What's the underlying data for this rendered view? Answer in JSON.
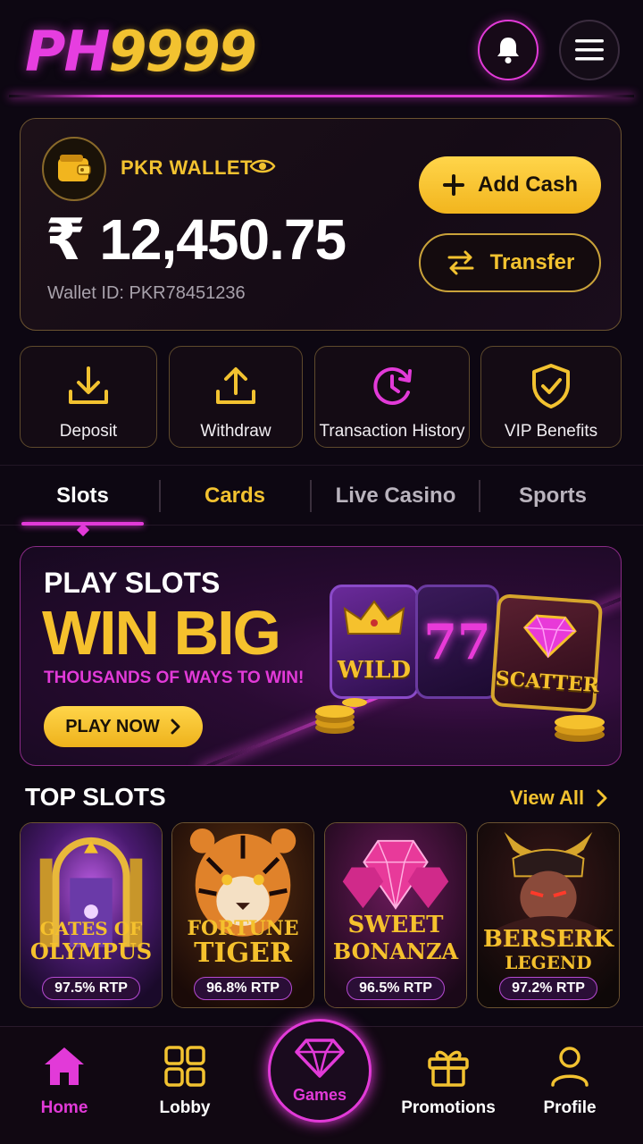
{
  "header": {
    "logo_ph": "PH",
    "logo_num": "9999",
    "icons": [
      "bell-icon",
      "menu-icon"
    ]
  },
  "wallet": {
    "label": "PKR WALLET",
    "currency_symbol": "₹",
    "amount": "12,450.75",
    "wallet_id": "Wallet ID: PKR78451236",
    "add_cash_label": "Add Cash",
    "transfer_label": "Transfer"
  },
  "quick_actions": [
    {
      "label": "Deposit",
      "icon": "download-icon"
    },
    {
      "label": "Withdraw",
      "icon": "upload-icon"
    },
    {
      "label": "Transaction History",
      "icon": "history-icon"
    },
    {
      "label": "VIP Benefits",
      "icon": "shield-check-icon"
    }
  ],
  "tabs": [
    {
      "label": "Slots",
      "active": true
    },
    {
      "label": "Cards",
      "active": false
    },
    {
      "label": "Live Casino",
      "active": false
    },
    {
      "label": "Sports",
      "active": false
    }
  ],
  "banner": {
    "line1": "PLAY SLOTS",
    "line2": "WIN BIG",
    "line3": "THOUSANDS OF WAYS TO WIN!",
    "cta": "PLAY NOW",
    "reel_wild": "WILD",
    "reel_seven": "77",
    "reel_scatter": "SCATTER"
  },
  "top_slots": {
    "title": "TOP SLOTS",
    "view_all": "View All",
    "games": [
      {
        "name_line1": "GATES OF",
        "name_line2": "OLYMPUS",
        "rtp": "97.5% RTP"
      },
      {
        "name_line1": "FORTUNE",
        "name_line2": "TIGER",
        "rtp": "96.8% RTP"
      },
      {
        "name_line1": "SWEET",
        "name_line2": "BONANZA",
        "rtp": "96.5% RTP"
      },
      {
        "name_line1": "BERSERK",
        "name_line2": "LEGEND",
        "rtp": "97.2% RTP"
      }
    ]
  },
  "bottom_nav": {
    "home": "Home",
    "lobby": "Lobby",
    "games": "Games",
    "promotions": "Promotions",
    "profile": "Profile"
  },
  "colors": {
    "accent_pink": "#e23ad8",
    "accent_gold": "#f2c230",
    "background": "#0d0712"
  }
}
